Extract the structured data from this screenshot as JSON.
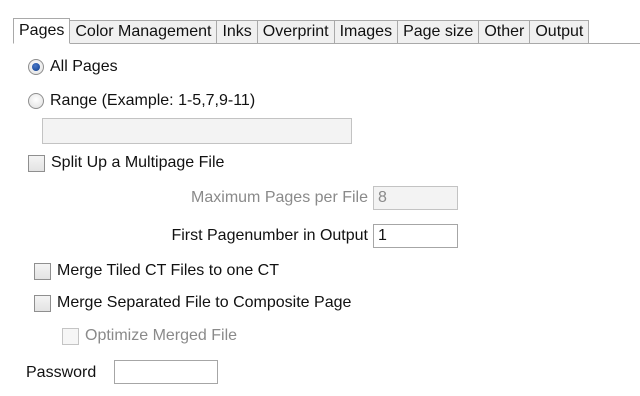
{
  "tabs": [
    {
      "label": "Pages",
      "active": true
    },
    {
      "label": "Color Management",
      "active": false
    },
    {
      "label": "Inks",
      "active": false
    },
    {
      "label": "Overprint",
      "active": false
    },
    {
      "label": "Images",
      "active": false
    },
    {
      "label": "Page size",
      "active": false
    },
    {
      "label": "Other",
      "active": false
    },
    {
      "label": "Output",
      "active": false
    }
  ],
  "pages": {
    "all_pages_label": "All Pages",
    "all_pages_selected": true,
    "range_label": "Range (Example: 1-5,7,9-11)",
    "range_value": "",
    "split_label": "Split Up a Multipage File",
    "split_checked": false,
    "max_pages_label": "Maximum Pages per File",
    "max_pages_value": "8",
    "first_page_label": "First Pagenumber in Output",
    "first_page_value": "1",
    "merge_tiled_label": "Merge Tiled CT Files to one CT",
    "merge_tiled_checked": false,
    "merge_separated_label": "Merge Separated File to Composite Page",
    "merge_separated_checked": false,
    "optimize_label": "Optimize Merged File",
    "optimize_checked": false,
    "password_label": "Password",
    "password_value": ""
  }
}
